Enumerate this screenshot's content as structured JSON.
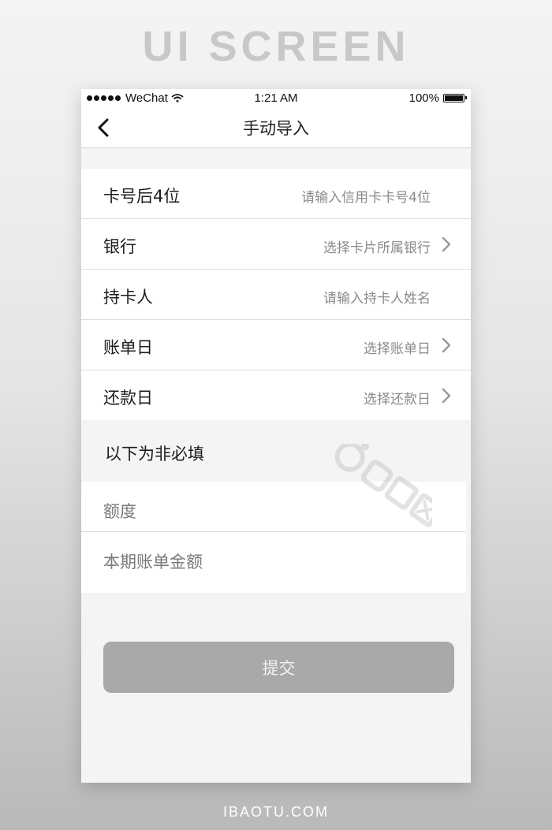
{
  "poster": {
    "title": "UI SCREEN",
    "footer": "IBAOTU.COM"
  },
  "status_bar": {
    "carrier": "WeChat",
    "time": "1:21 AM",
    "battery": "100%"
  },
  "nav": {
    "title": "手动导入",
    "back_icon": "chevron-left-icon"
  },
  "form": {
    "rows": [
      {
        "label": "卡号后4位",
        "value": "请输入信用卡卡号4位",
        "chevron": false
      },
      {
        "label": "银行",
        "value": "选择卡片所属银行",
        "chevron": true
      },
      {
        "label": "持卡人",
        "value": "请输入持卡人姓名",
        "chevron": false
      },
      {
        "label": "账单日",
        "value": "选择账单日",
        "chevron": true
      },
      {
        "label": "还款日",
        "value": "选择还款日",
        "chevron": true
      }
    ]
  },
  "optional": {
    "header": "以下为非必填",
    "fields": [
      {
        "placeholder": "额度"
      },
      {
        "placeholder": "本期账单金额"
      }
    ]
  },
  "submit": {
    "label": "提交"
  },
  "colors": {
    "button_bg": "#a9a9a9",
    "page_bg": "#f4f4f4",
    "card_bg": "#ffffff"
  }
}
